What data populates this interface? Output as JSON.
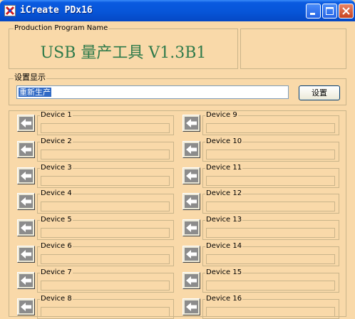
{
  "window": {
    "title": "iCreate PDx16"
  },
  "program_group": {
    "label": "Production Program Name",
    "program_name": "USB 量产工具 V1.3B1"
  },
  "settings_group": {
    "label": "设置显示",
    "input_value": "重新生产",
    "button_label": "设置"
  },
  "devices": [
    {
      "label": "Device 1"
    },
    {
      "label": "Device 2"
    },
    {
      "label": "Device 3"
    },
    {
      "label": "Device 4"
    },
    {
      "label": "Device 5"
    },
    {
      "label": "Device 6"
    },
    {
      "label": "Device 7"
    },
    {
      "label": "Device 8"
    },
    {
      "label": "Device 9"
    },
    {
      "label": "Device 10"
    },
    {
      "label": "Device 11"
    },
    {
      "label": "Device 12"
    },
    {
      "label": "Device 13"
    },
    {
      "label": "Device 14"
    },
    {
      "label": "Device 15"
    },
    {
      "label": "Device 16"
    }
  ]
}
